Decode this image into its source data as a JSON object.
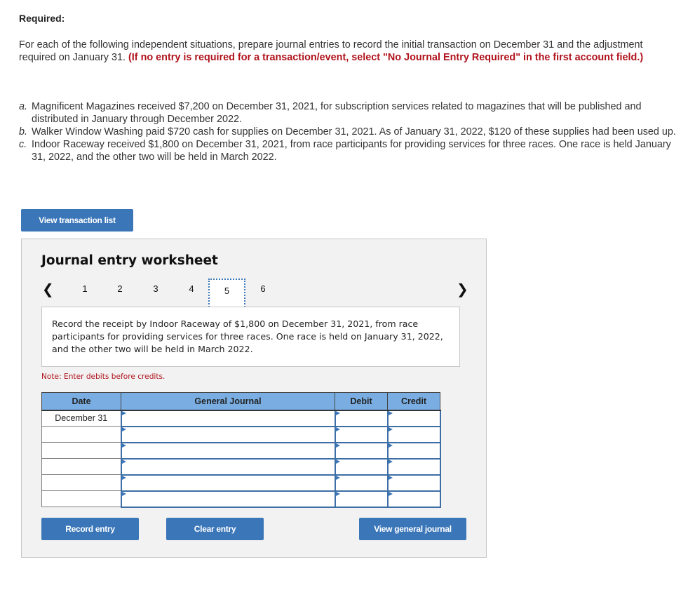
{
  "required_heading": "Required:",
  "instructions": {
    "text": "For each of the following independent situations, prepare journal entries to record the initial transaction on December 31 and the adjustment required on January 31. ",
    "emphasis": "(If no entry is required for a transaction/event, select \"No Journal Entry Required\" in the first account field.)"
  },
  "situations": [
    {
      "label": "a.",
      "text": "Magnificent Magazines received $7,200 on December 31, 2021, for subscription services related to magazines that will be published and distributed in January through December 2022."
    },
    {
      "label": "b.",
      "text": "Walker Window Washing paid $720 cash for supplies on December 31, 2021. As of January 31, 2022, $120 of these supplies had been used up."
    },
    {
      "label": "c.",
      "text": "Indoor Raceway received $1,800 on December 31, 2021, from race participants for providing services for three races. One race is held January 31, 2022, and the other two will be held in March 2022."
    }
  ],
  "buttons": {
    "view_transaction_list": "View transaction list",
    "record_entry": "Record entry",
    "clear_entry": "Clear entry",
    "view_general_journal": "View general journal"
  },
  "worksheet": {
    "title": "Journal entry worksheet",
    "pager": {
      "prev_icon": "chevron-left",
      "next_icon": "chevron-right",
      "pages": [
        "1",
        "2",
        "3",
        "4",
        "5",
        "6"
      ],
      "active_page": "5"
    },
    "prompt": "Record the receipt by Indoor Raceway of $1,800 on December 31, 2021, from race participants for providing services for three races. One race is held on January 31, 2022, and the other two will be held in March 2022.",
    "note": "Note: Enter debits before credits.",
    "table": {
      "headers": {
        "date": "Date",
        "general_journal": "General Journal",
        "debit": "Debit",
        "credit": "Credit"
      },
      "rows": [
        {
          "date": "December 31",
          "account": "",
          "debit": "",
          "credit": ""
        },
        {
          "date": "",
          "account": "",
          "debit": "",
          "credit": ""
        },
        {
          "date": "",
          "account": "",
          "debit": "",
          "credit": ""
        },
        {
          "date": "",
          "account": "",
          "debit": "",
          "credit": ""
        },
        {
          "date": "",
          "account": "",
          "debit": "",
          "credit": ""
        },
        {
          "date": "",
          "account": "",
          "debit": "",
          "credit": ""
        }
      ]
    }
  },
  "colors": {
    "button_blue": "#3a76b8",
    "header_blue": "#7aaee3",
    "emphasis_red": "#b0141d",
    "panel_gray": "#f2f2f2"
  }
}
